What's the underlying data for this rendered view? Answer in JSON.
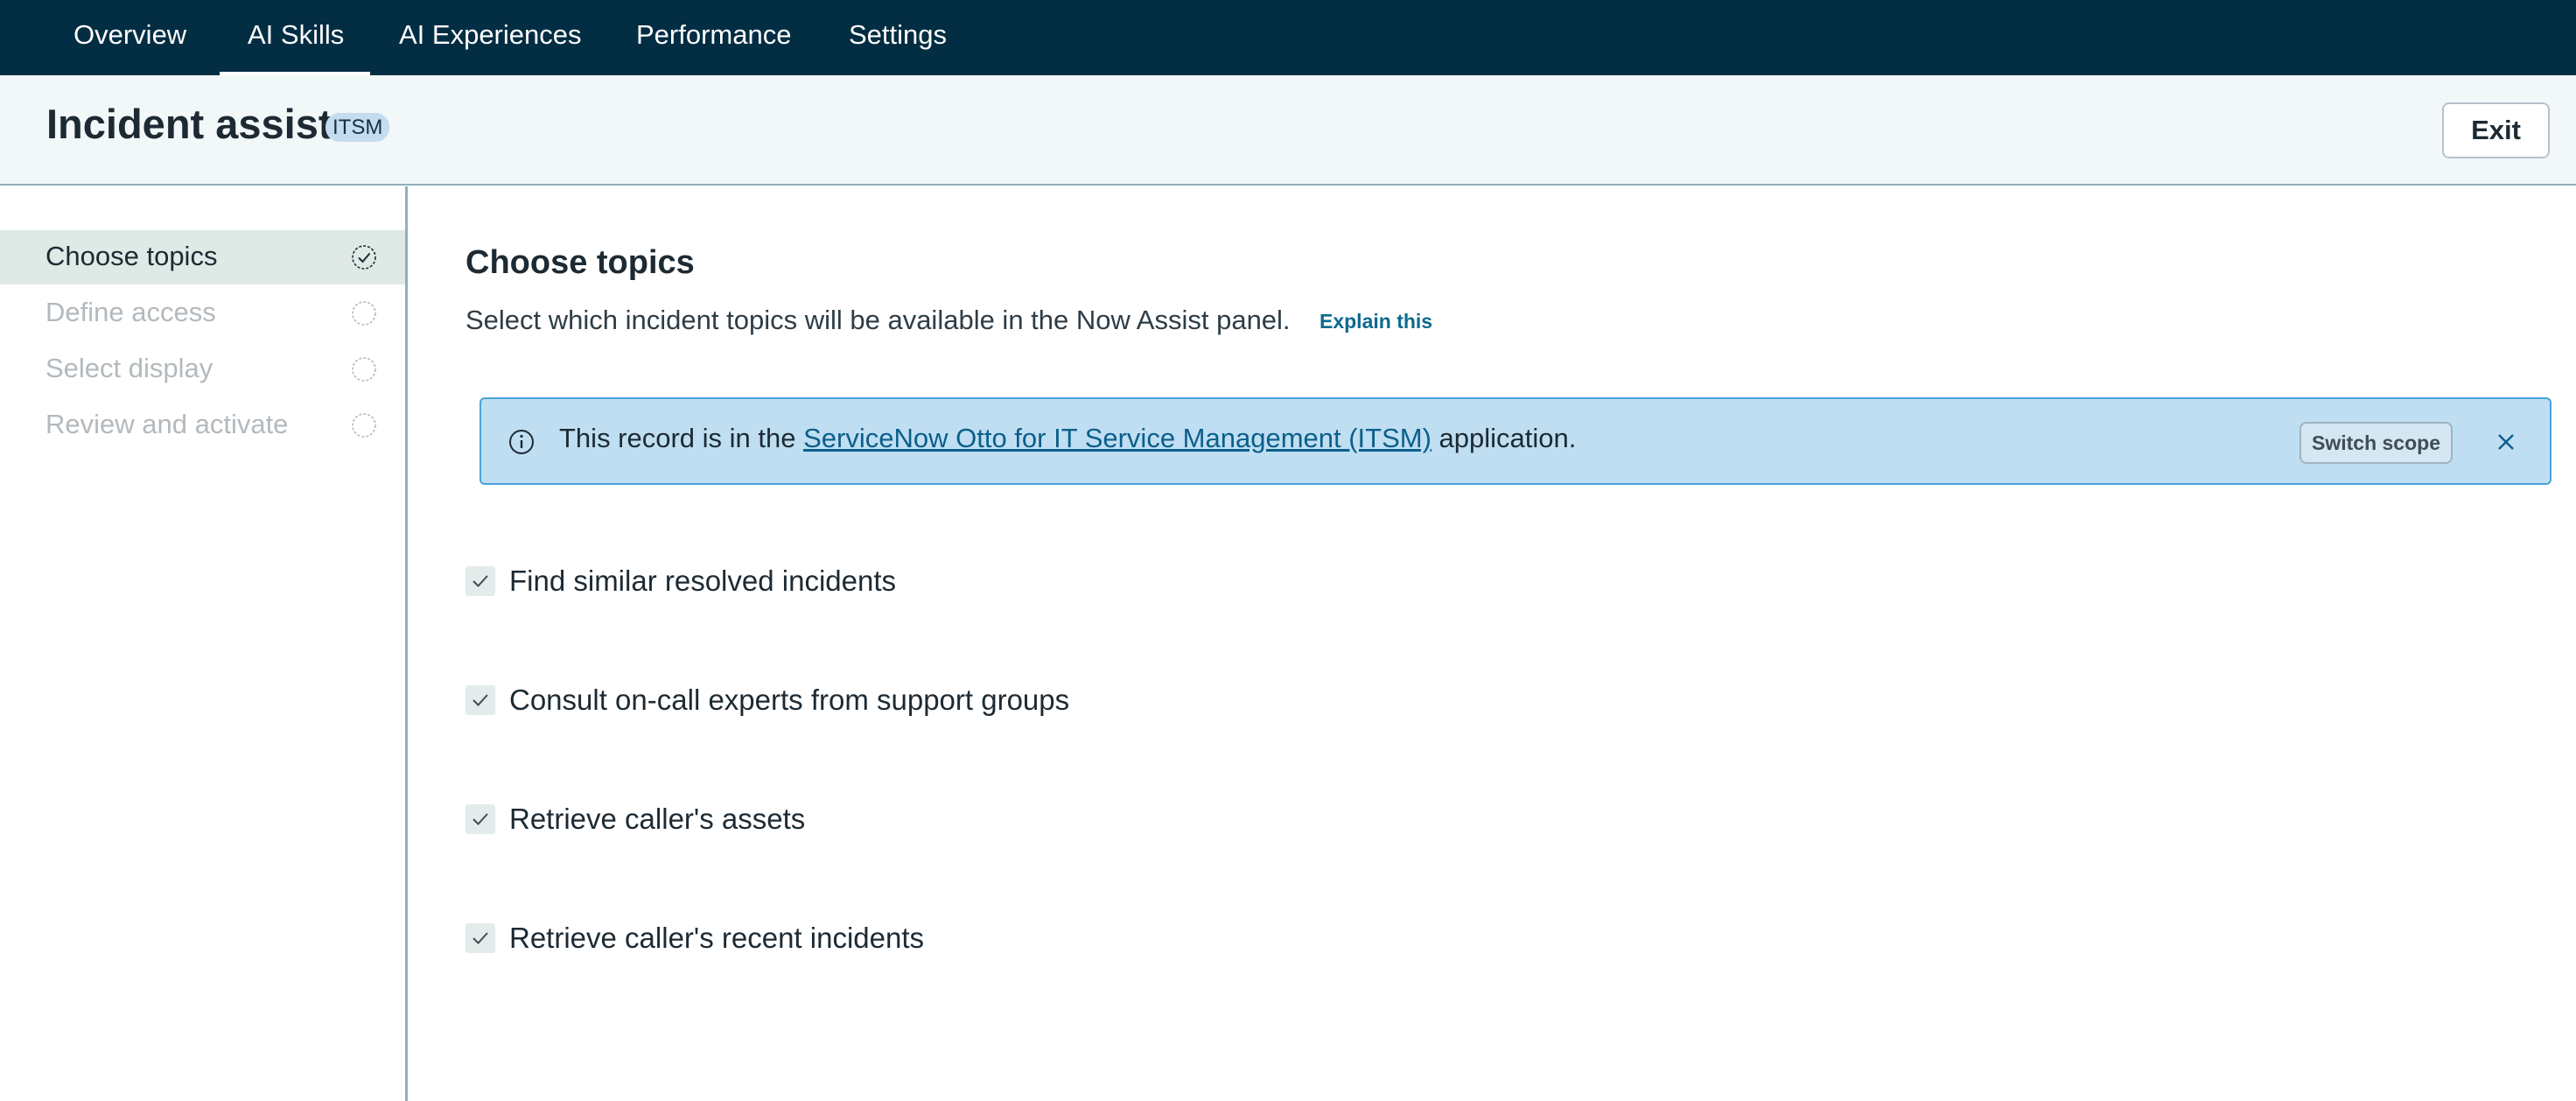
{
  "nav": {
    "tabs": [
      {
        "label": "Overview"
      },
      {
        "label": "AI Skills",
        "active": true
      },
      {
        "label": "AI Experiences"
      },
      {
        "label": "Performance"
      },
      {
        "label": "Settings"
      }
    ]
  },
  "header": {
    "title": "Incident assist",
    "badge": "ITSM",
    "exit_label": "Exit"
  },
  "sidebar": {
    "steps": [
      {
        "label": "Choose topics",
        "status": "complete"
      },
      {
        "label": "Define access",
        "status": "pending"
      },
      {
        "label": "Select display",
        "status": "pending"
      },
      {
        "label": "Review and activate",
        "status": "pending"
      }
    ]
  },
  "main": {
    "title": "Choose topics",
    "description": "Select which incident topics will be available in the Now Assist panel.",
    "explain_link": "Explain this",
    "banner": {
      "text_before": "This record is in the ",
      "link_text": "ServiceNow Otto for IT Service Management (ITSM)",
      "text_after": " application.",
      "switch_scope_label": "Switch scope",
      "icon": "info-icon"
    },
    "topics": [
      {
        "label": "Find similar resolved incidents",
        "checked": true
      },
      {
        "label": "Consult on-call experts from support groups",
        "checked": true
      },
      {
        "label": "Retrieve caller's assets",
        "checked": true
      },
      {
        "label": "Retrieve caller's recent incidents",
        "checked": true
      }
    ]
  },
  "colors": {
    "nav_bg": "#032d42",
    "header_bg": "#f2f7f8",
    "active_step_bg": "#dfe9e6",
    "banner_bg": "#bfdef2",
    "banner_border": "#4aa3d8",
    "link": "#0c6a8f"
  }
}
